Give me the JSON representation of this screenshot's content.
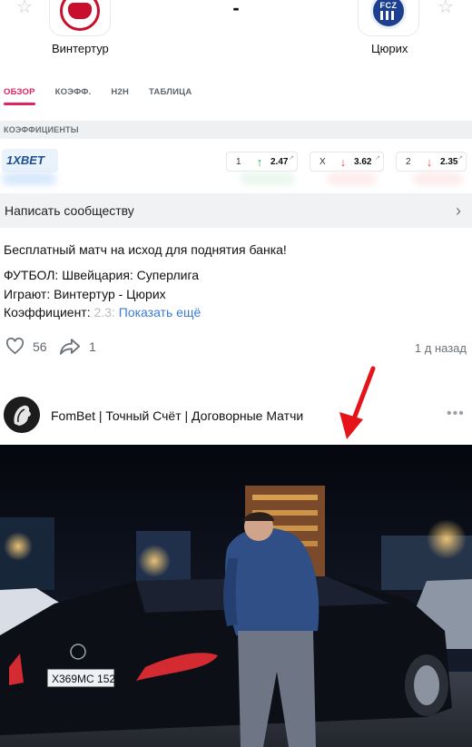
{
  "match": {
    "home_team": "Винтертур",
    "away_team": "Цюрих",
    "score": "-"
  },
  "tabs": [
    {
      "label": "ОБЗОР",
      "active": true
    },
    {
      "label": "КОЭФФ.",
      "active": false
    },
    {
      "label": "H2H",
      "active": false
    },
    {
      "label": "ТАБЛИЦА",
      "active": false
    }
  ],
  "odds": {
    "section_title": "КОЭФФИЦИЕНТЫ",
    "bookmaker": "1XBET",
    "items": [
      {
        "key": "1",
        "value": "2.47",
        "trend": "up"
      },
      {
        "key": "X",
        "value": "3.62",
        "trend": "down"
      },
      {
        "key": "2",
        "value": "2.35",
        "trend": "down"
      }
    ]
  },
  "write_message": {
    "label": "Написать сообществу"
  },
  "post": {
    "lines": [
      "Бесплатный матч на исход для поднятия банка!",
      "ФУТБОЛ: Швейцария: Суперлига",
      "Играют: Винтертур - Цюрих"
    ],
    "coef_label": "Коэффициент: ",
    "coef_faded": "2.3",
    "show_more": "Показать ещё",
    "likes": "56",
    "shares": "1",
    "time_ago": "1 д назад"
  },
  "next_post": {
    "author": "FomBet | Точный Счёт | Договорные Матчи",
    "photo_plate": "Х369МС 152"
  },
  "colors": {
    "accent": "#e0245e",
    "odd_up": "#1faa59",
    "odd_down": "#e5484d",
    "link": "#3b7bd6",
    "annotation_arrow": "#e5141b"
  }
}
